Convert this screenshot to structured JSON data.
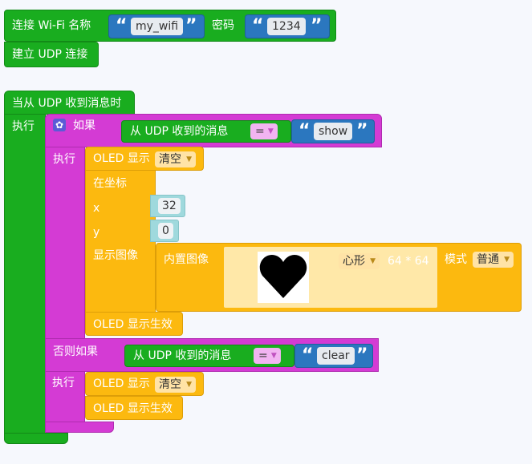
{
  "wifi": {
    "label": "连接 Wi-Fi 名称",
    "ssid": "my_wifi",
    "password_label": "密码",
    "password": "1234"
  },
  "udp_connect": {
    "label": "建立 UDP 连接"
  },
  "event": {
    "title": "当从 UDP 收到消息时",
    "do_label": "执行",
    "if_label": "如果",
    "condition1": {
      "left": "从 UDP 收到的消息",
      "op": "=",
      "value": "show"
    },
    "then_label": "执行",
    "oled_show_label": "OLED 显示",
    "oled_show_value": "清空",
    "at_coords_label": "在坐标",
    "x_label": "x",
    "x_value": "32",
    "y_label": "y",
    "y_value": "0",
    "show_image_label": "显示图像",
    "builtin_image_label": "内置图像",
    "image_name": "心形",
    "image_size": "64 * 64",
    "mode_label": "模式",
    "mode_value": "普通",
    "oled_apply_label": "OLED 显示生效",
    "elseif_label": "否则如果",
    "condition2": {
      "left": "从 UDP 收到的消息",
      "op": "=",
      "value": "clear"
    },
    "then2_label": "执行",
    "oled_show2_label": "OLED 显示",
    "oled_show2_value": "清空",
    "oled_apply2_label": "OLED 显示生效"
  },
  "colors": {
    "event_green": "#19ad1f",
    "logic_pink": "#d43bd4",
    "oled_yellow": "#fcb90f",
    "text_blue": "#2b77bf",
    "math_cyan": "#9fd9dd"
  },
  "icons": {
    "gear": "gear-icon",
    "heart": "heart-icon",
    "dropdown": "chevron-down-icon"
  }
}
